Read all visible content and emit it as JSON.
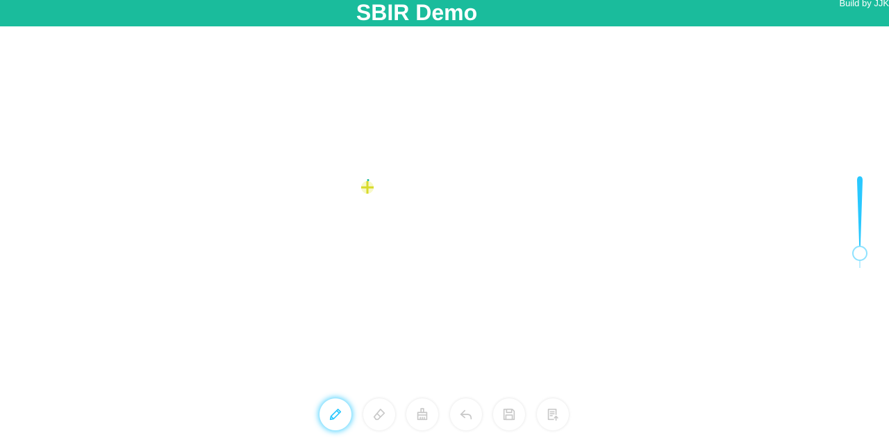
{
  "header": {
    "title": "SBIR Demo",
    "credit": "Build by JJK",
    "background_color": "#1abc9c"
  },
  "canvas": {
    "cursor_icon": "crosshair-plus-icon",
    "cursor_color": "#e6e83a"
  },
  "brush_size_slider": {
    "accent_color": "#29c8ff",
    "value_fraction": 0.85
  },
  "toolbar": {
    "tools": [
      {
        "id": "pencil",
        "icon": "pencil-icon",
        "active": true
      },
      {
        "id": "eraser",
        "icon": "eraser-icon",
        "active": false
      },
      {
        "id": "clear",
        "icon": "broom-icon",
        "active": false
      },
      {
        "id": "undo",
        "icon": "undo-icon",
        "active": false
      },
      {
        "id": "save",
        "icon": "save-icon",
        "active": false
      },
      {
        "id": "submit",
        "icon": "document-upload-icon",
        "active": false
      }
    ],
    "active_color": "#29c8ff",
    "inactive_color": "#c8c8c8"
  }
}
